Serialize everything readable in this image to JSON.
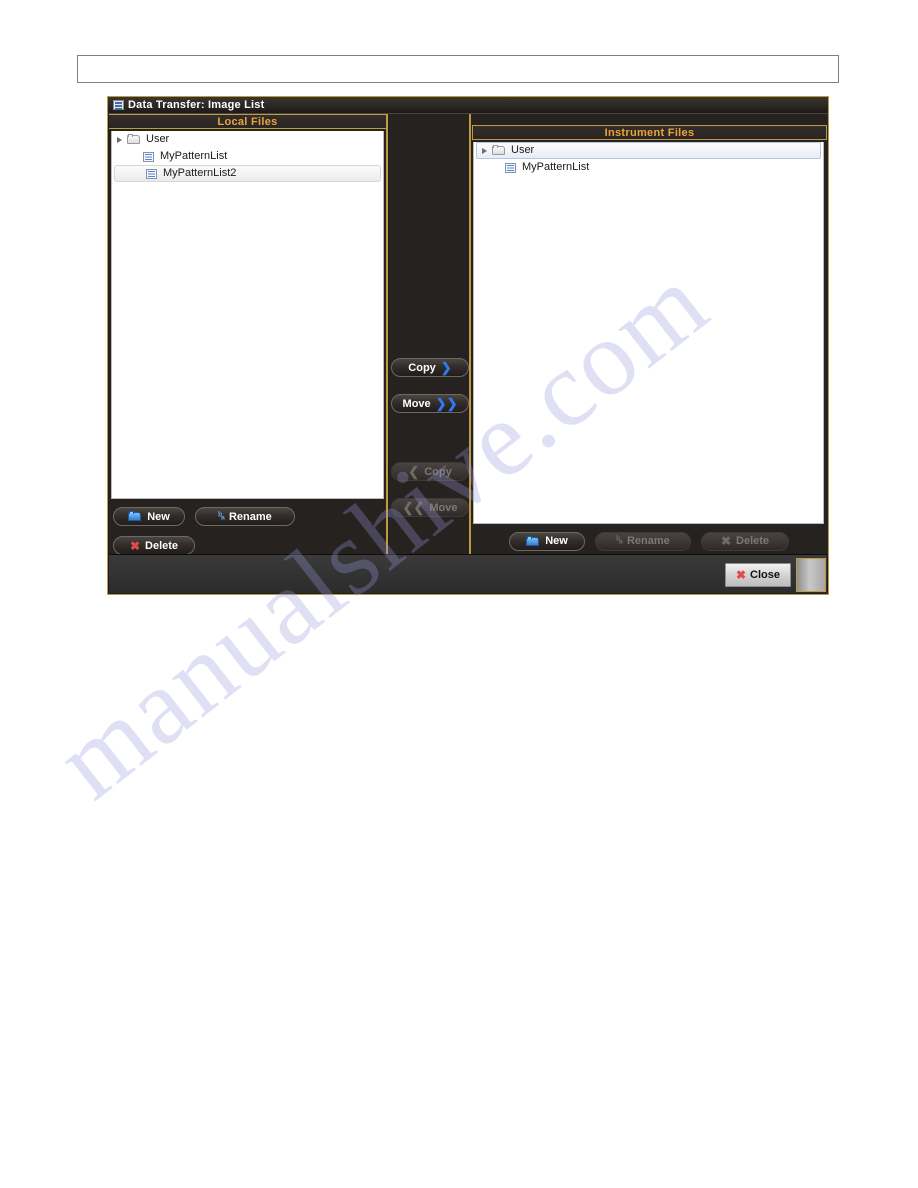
{
  "window": {
    "title": "Data Transfer: Image List",
    "title_icon": "list-icon"
  },
  "header_box": {
    "text": ""
  },
  "watermark": {
    "text": "manualshive.com"
  },
  "colors": {
    "accent_gold": "#c09a42",
    "header_text": "#e8a33d",
    "window_bg": "#201d1c",
    "list_bg": "#ffffff",
    "arrow_blue": "#2d7bf0",
    "delete_red": "#e24a4a"
  },
  "local_panel": {
    "header": "Local Files",
    "tree": [
      {
        "label": "User",
        "icon": "folder-icon",
        "level": 0,
        "expanded": true,
        "selected": false
      },
      {
        "label": "MyPatternList",
        "icon": "list-icon",
        "level": 1,
        "expanded": false,
        "selected": false
      },
      {
        "label": "MyPatternList2",
        "icon": "list-icon",
        "level": 1,
        "expanded": false,
        "selected": true
      }
    ],
    "buttons": {
      "new": "New",
      "rename": "Rename",
      "delete": "Delete"
    }
  },
  "transfer_buttons": {
    "copy_right": {
      "label": "Copy",
      "arrow": "❯",
      "enabled": true
    },
    "move_right": {
      "label": "Move",
      "arrow": "❯❯",
      "enabled": true
    },
    "copy_left": {
      "label": "Copy",
      "arrow": "❮",
      "enabled": false
    },
    "move_left": {
      "label": "Move",
      "arrow": "❮❮",
      "enabled": false
    }
  },
  "instrument_panel": {
    "header": "Instrument Files",
    "tree": [
      {
        "label": "User",
        "icon": "folder-icon",
        "level": 0,
        "expanded": true,
        "selected": true
      },
      {
        "label": "MyPatternList",
        "icon": "list-icon",
        "level": 1,
        "expanded": false,
        "selected": false
      }
    ],
    "buttons": {
      "new": "New",
      "rename": "Rename",
      "delete": "Delete"
    }
  },
  "status_bar": {
    "close": "Close"
  }
}
